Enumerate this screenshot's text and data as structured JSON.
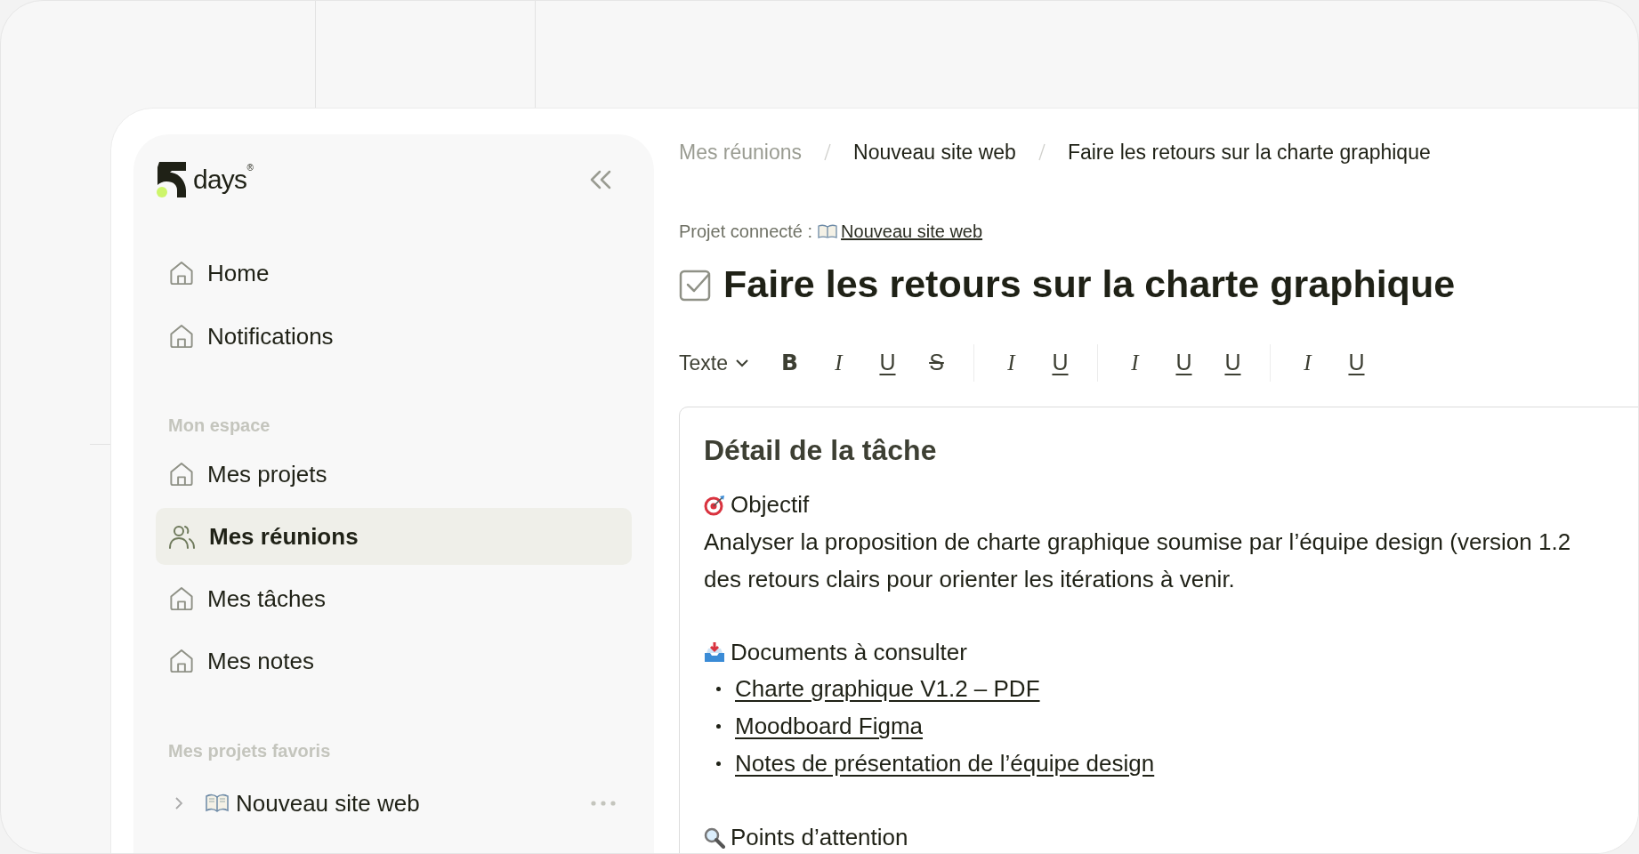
{
  "sidebar": {
    "brand": "days",
    "brand_mark": "®",
    "items": [
      {
        "label": "Home",
        "kind": "house",
        "selected": false
      },
      {
        "label": "Notifications",
        "kind": "house",
        "selected": false
      }
    ],
    "sections": [
      {
        "title": "Mon espace",
        "items": [
          {
            "label": "Mes projets",
            "kind": "house",
            "selected": false
          },
          {
            "label": "Mes réunions",
            "kind": "people",
            "selected": true
          },
          {
            "label": "Mes tâches",
            "kind": "house",
            "selected": false
          },
          {
            "label": "Mes notes",
            "kind": "house",
            "selected": false
          }
        ]
      },
      {
        "title": "Mes projets favoris",
        "favorites": [
          {
            "label": "Nouveau site web",
            "expanded": false
          }
        ]
      }
    ]
  },
  "breadcrumb": [
    {
      "label": "Mes réunions",
      "current": false
    },
    {
      "label": "Nouveau site web",
      "current": true
    },
    {
      "label": "Faire les retours sur la charte graphique",
      "current": true
    }
  ],
  "connected_project": {
    "label": "Projet connecté :",
    "link": "Nouveau site web"
  },
  "task": {
    "title": "Faire les retours sur la charte graphique",
    "checked": true
  },
  "toolbar": {
    "style": "Texte",
    "groups": [
      [
        {
          "label": "B",
          "kind": "bold"
        },
        {
          "label": "I",
          "kind": "italic"
        },
        {
          "label": "U",
          "kind": "underline"
        },
        {
          "label": "S",
          "kind": "strike"
        }
      ],
      [
        {
          "label": "I",
          "kind": "italic"
        },
        {
          "label": "U",
          "kind": "underline"
        }
      ],
      [
        {
          "label": "I",
          "kind": "italic"
        },
        {
          "label": "U",
          "kind": "underline"
        },
        {
          "label": "U",
          "kind": "underline"
        }
      ],
      [
        {
          "label": "I",
          "kind": "italic"
        },
        {
          "label": "U",
          "kind": "underline"
        }
      ]
    ]
  },
  "editor": {
    "heading": "Détail de la tâche",
    "blocks": [
      {
        "kind": "section",
        "title": "Objectif",
        "lines": [
          "Analyser la proposition de charte graphique soumise par l’équipe design (version 1.2",
          "des retours clairs pour orienter les itérations à venir."
        ]
      },
      {
        "kind": "section",
        "title": "Documents à consulter",
        "links": [
          "Charte graphique V1.2 – PDF",
          "Moodboard Figma",
          "Notes de présentation de l’équipe design"
        ]
      },
      {
        "kind": "section",
        "title": "Points d’attention"
      }
    ]
  }
}
